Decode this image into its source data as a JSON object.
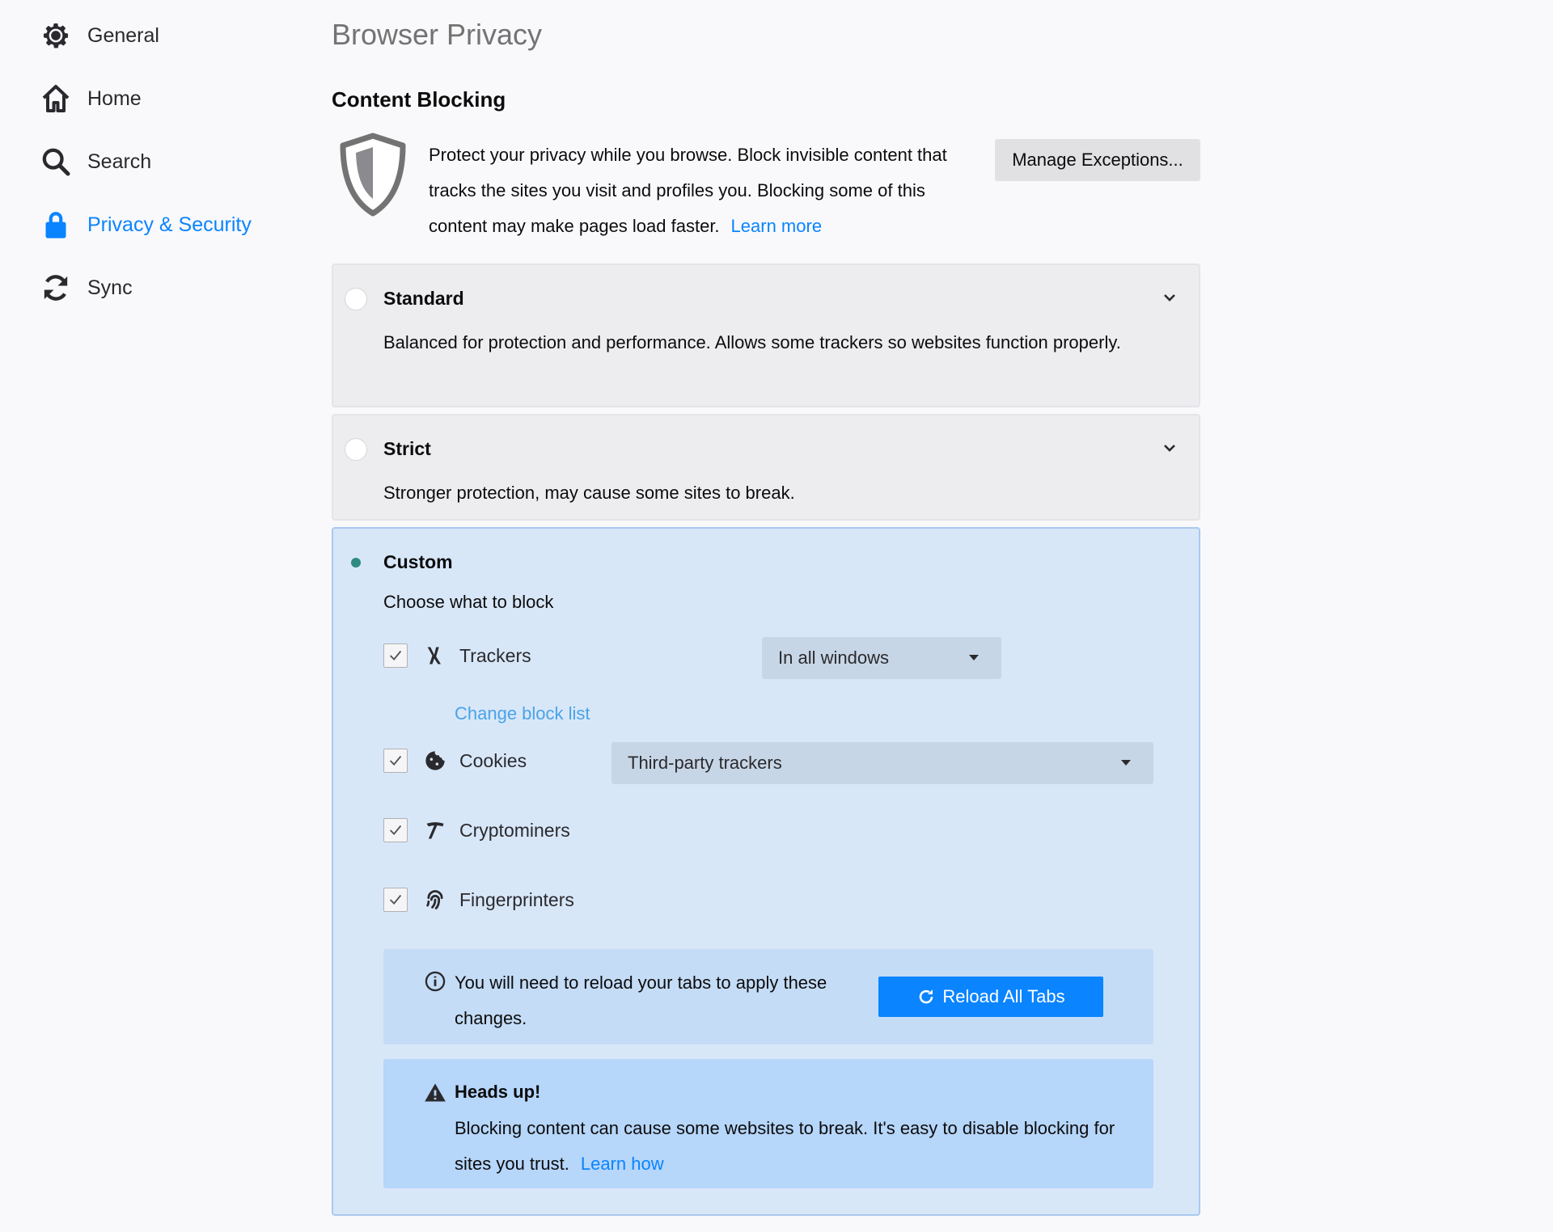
{
  "sidebar": {
    "items": [
      {
        "label": "General",
        "icon": "gear-icon"
      },
      {
        "label": "Home",
        "icon": "home-icon"
      },
      {
        "label": "Search",
        "icon": "search-icon"
      },
      {
        "label": "Privacy & Security",
        "icon": "lock-icon",
        "selected": true
      },
      {
        "label": "Sync",
        "icon": "sync-icon"
      }
    ]
  },
  "page": {
    "title": "Browser Privacy",
    "section_title": "Content Blocking",
    "intro_text": "Protect your privacy while you browse. Block invisible content that tracks the sites you visit and profiles you. Blocking some of this content may make pages load faster.",
    "learn_more": "Learn more",
    "manage_exceptions": "Manage Exceptions..."
  },
  "options": {
    "standard": {
      "title": "Standard",
      "description": "Balanced for protection and performance. Allows some trackers so websites function properly."
    },
    "strict": {
      "title": "Strict",
      "description": "Stronger protection, may cause some sites to break."
    },
    "custom": {
      "title": "Custom",
      "choose_label": "Choose what to block",
      "trackers": {
        "label": "Trackers",
        "checked": true,
        "select_value": "In all windows"
      },
      "change_block_list": "Change block list",
      "cookies": {
        "label": "Cookies",
        "checked": true,
        "select_value": "Third-party trackers"
      },
      "cryptominers": {
        "label": "Cryptominers",
        "checked": true
      },
      "fingerprinters": {
        "label": "Fingerprinters",
        "checked": true
      },
      "reload_notice": "You will need to reload your tabs to apply these changes.",
      "reload_button": "Reload All Tabs",
      "warning_title": "Heads up!",
      "warning_text": "Blocking content can cause some websites to break. It's easy to disable blocking for sites you trust.",
      "learn_how": "Learn how"
    }
  },
  "colors": {
    "accent": "#0a84ff",
    "custom_bg": "#d8e7f8",
    "selected_radio": "#2e8a83"
  }
}
